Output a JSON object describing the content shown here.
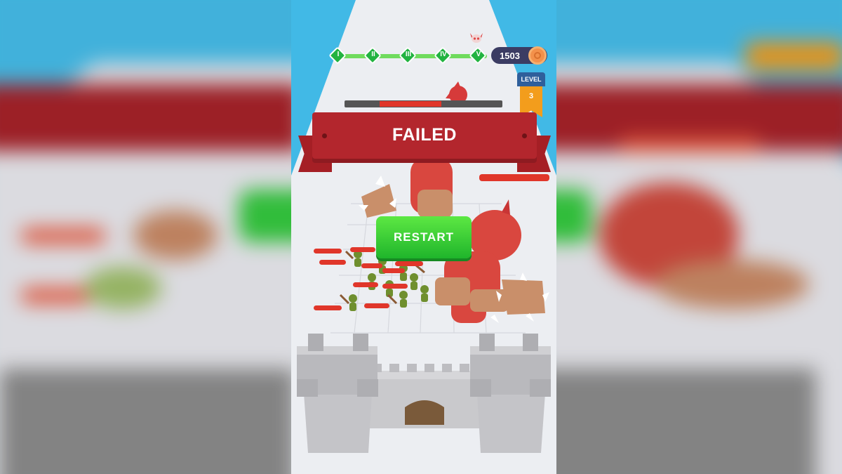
{
  "hud": {
    "stages": [
      "I",
      "II",
      "III",
      "IV",
      "V"
    ],
    "coins": "1503",
    "level_label": "LEVEL",
    "level_number": "3"
  },
  "banner": {
    "title": "FAILED"
  },
  "restart_label": "RESTART",
  "colors": {
    "sky": "#41b9e6",
    "banner_red": "#b3262d",
    "restart_green": "#2fc236",
    "stage_green": "#22b341",
    "coin_orange": "#f3914b",
    "level_orange": "#f39d1c"
  },
  "icons": [
    "skull-icon",
    "coin-icon"
  ]
}
